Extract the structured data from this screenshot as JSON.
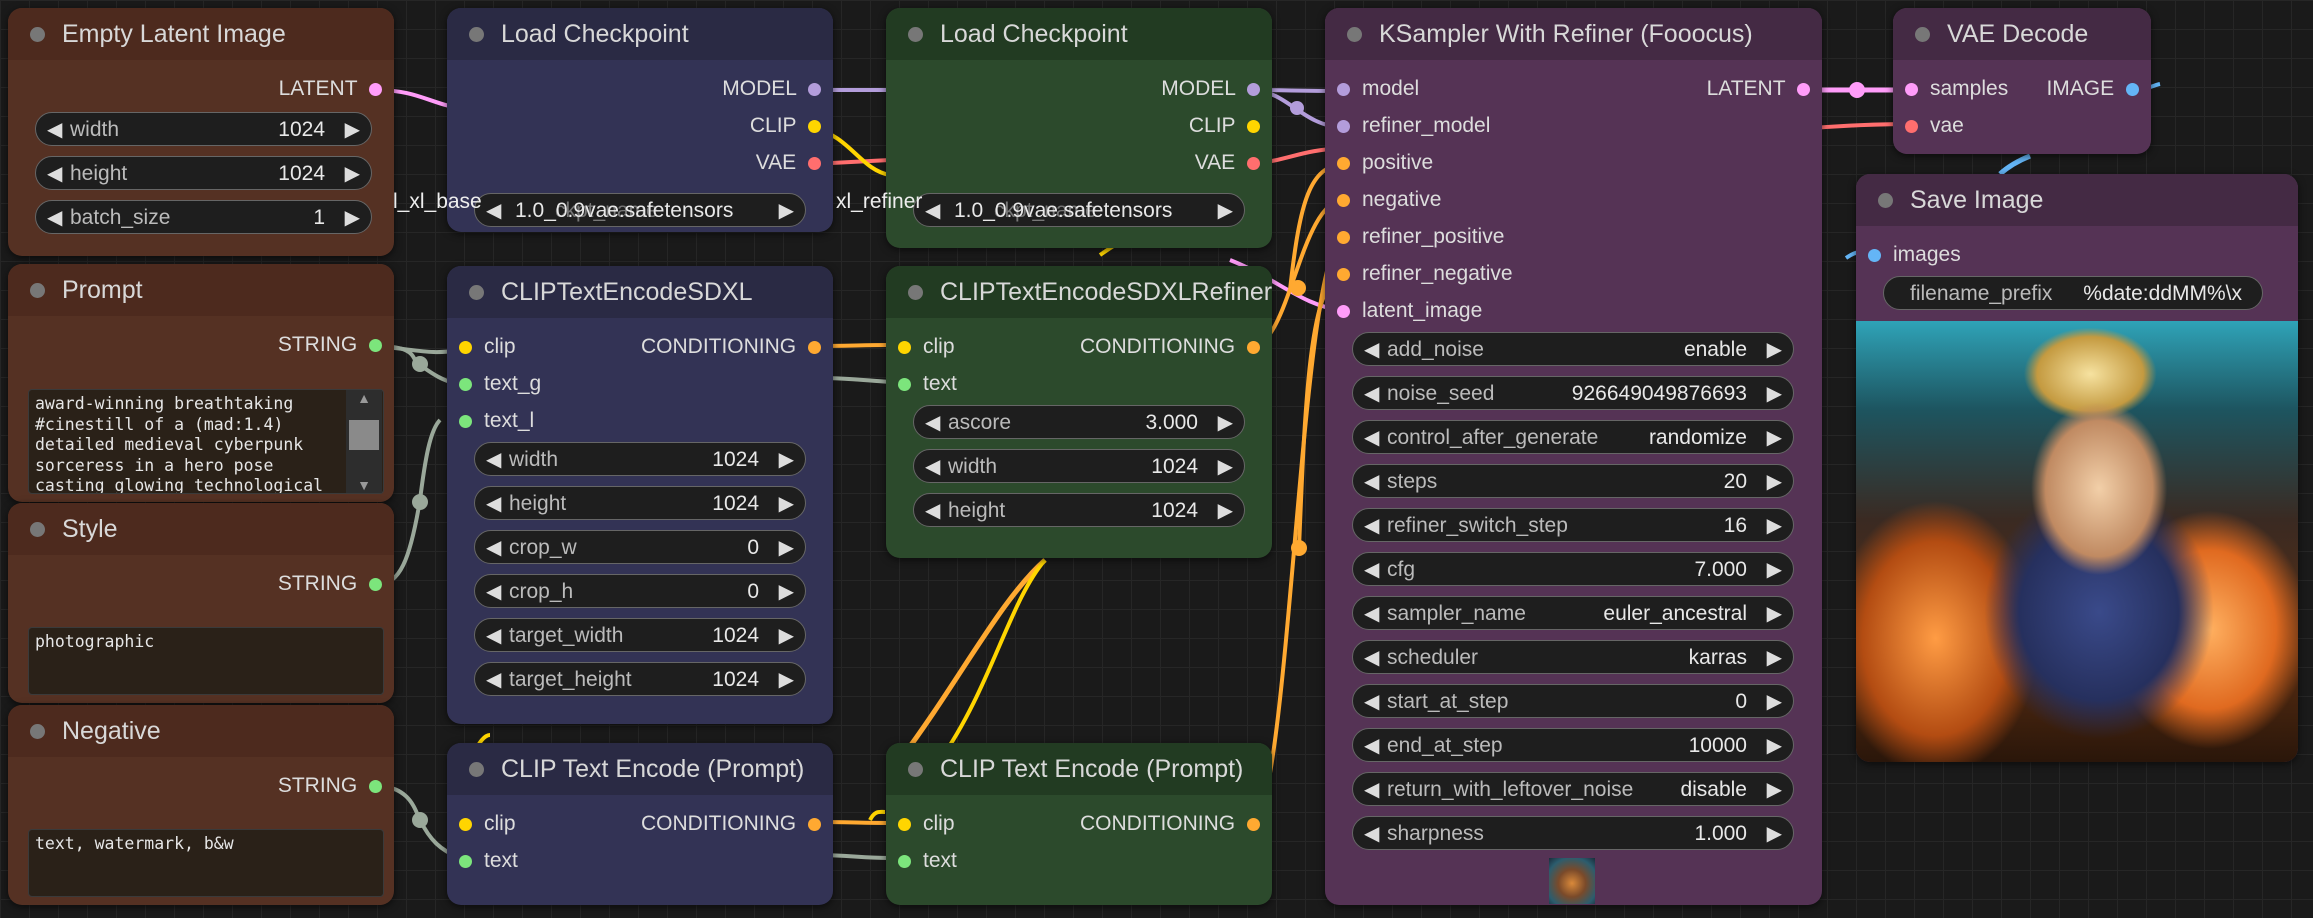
{
  "colors": {
    "latent": "#ff9cf9",
    "model": "#b39ddb",
    "clip": "#ffd500",
    "vae": "#ff6e6e",
    "conditioning": "#ffa931",
    "string": "#7ce57c",
    "image": "#64b5f6",
    "nodeBrown": "#553123",
    "nodeBrownTitle": "#4d2a1e",
    "nodeBlue": "#333355",
    "nodeBlueTitle": "#2a2a44",
    "nodeGreen": "#2c4a2c",
    "nodeGreenTitle": "#223b22",
    "nodePurple": "#553355",
    "nodePurpleTitle": "#442a44"
  },
  "emptyLatent": {
    "title": "Empty Latent Image",
    "output": "LATENT",
    "width": {
      "label": "width",
      "value": "1024"
    },
    "height": {
      "label": "height",
      "value": "1024"
    },
    "batch": {
      "label": "batch_size",
      "value": "1"
    }
  },
  "prompt": {
    "title": "Prompt",
    "output": "STRING",
    "text": "award-winning breathtaking\n#cinestill of a (mad:1.4)\ndetailed medieval cyberpunk\nsorceress in a hero pose\ncasting glowing technological"
  },
  "style": {
    "title": "Style",
    "output": "STRING",
    "text": "photographic"
  },
  "negative": {
    "title": "Negative",
    "output": "STRING",
    "text": "text, watermark, b&w"
  },
  "loadCkpt1": {
    "title": "Load Checkpoint",
    "outputs": [
      "MODEL",
      "CLIP",
      "VAE"
    ],
    "ckptValue": "1.0_0.9vae.safetensors",
    "ckptOverflow": "l_xl_base",
    "ckptLabel": "ckpt_name"
  },
  "loadCkpt2": {
    "title": "Load Checkpoint",
    "outputs": [
      "MODEL",
      "CLIP",
      "VAE"
    ],
    "ckptValue": "1.0_0.9vae.safetensors",
    "ckptOverflow": "xl_refiner",
    "ckptLabel": "ckpt_name"
  },
  "clipSDXL": {
    "title": "CLIPTextEncodeSDXL",
    "inputs": [
      "clip",
      "text_g",
      "text_l"
    ],
    "output": "CONDITIONING",
    "widgets": [
      {
        "label": "width",
        "value": "1024"
      },
      {
        "label": "height",
        "value": "1024"
      },
      {
        "label": "crop_w",
        "value": "0"
      },
      {
        "label": "crop_h",
        "value": "0"
      },
      {
        "label": "target_width",
        "value": "1024"
      },
      {
        "label": "target_height",
        "value": "1024"
      }
    ]
  },
  "clipRefiner": {
    "title": "CLIPTextEncodeSDXLRefiner",
    "inputs": [
      "clip",
      "text"
    ],
    "output": "CONDITIONING",
    "widgets": [
      {
        "label": "ascore",
        "value": "3.000"
      },
      {
        "label": "width",
        "value": "1024"
      },
      {
        "label": "height",
        "value": "1024"
      }
    ]
  },
  "clipText1": {
    "title": "CLIP Text Encode (Prompt)",
    "inputs": [
      "clip",
      "text"
    ],
    "output": "CONDITIONING"
  },
  "clipText2": {
    "title": "CLIP Text Encode (Prompt)",
    "inputs": [
      "clip",
      "text"
    ],
    "output": "CONDITIONING"
  },
  "ksampler": {
    "title": "KSampler With Refiner (Fooocus)",
    "inputs": [
      "model",
      "refiner_model",
      "positive",
      "negative",
      "refiner_positive",
      "refiner_negative",
      "latent_image"
    ],
    "output": "LATENT",
    "widgets": [
      {
        "label": "add_noise",
        "value": "enable"
      },
      {
        "label": "noise_seed",
        "value": "926649049876693"
      },
      {
        "label": "control_after_generate",
        "value": "randomize"
      },
      {
        "label": "steps",
        "value": "20"
      },
      {
        "label": "refiner_switch_step",
        "value": "16"
      },
      {
        "label": "cfg",
        "value": "7.000"
      },
      {
        "label": "sampler_name",
        "value": "euler_ancestral"
      },
      {
        "label": "scheduler",
        "value": "karras"
      },
      {
        "label": "start_at_step",
        "value": "0"
      },
      {
        "label": "end_at_step",
        "value": "10000"
      },
      {
        "label": "return_with_leftover_noise",
        "value": "disable"
      },
      {
        "label": "sharpness",
        "value": "1.000"
      }
    ]
  },
  "vaeDecode": {
    "title": "VAE Decode",
    "inputs": [
      "samples",
      "vae"
    ],
    "output": "IMAGE"
  },
  "saveImage": {
    "title": "Save Image",
    "input": "images",
    "prefix": {
      "label": "filename_prefix",
      "value": "%date:ddMM%\\x"
    }
  }
}
